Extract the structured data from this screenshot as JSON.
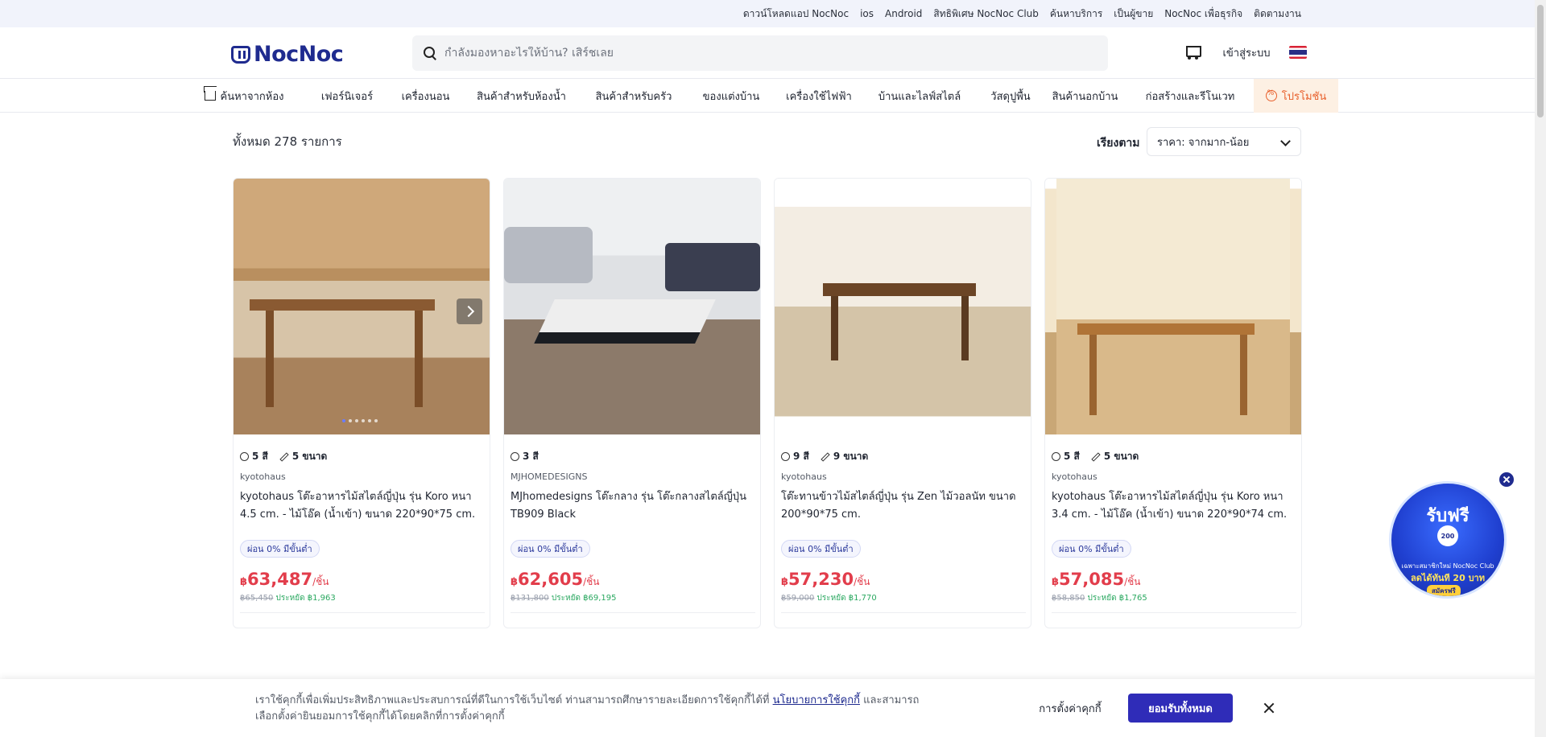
{
  "topbar": {
    "download_app": "ดาวน์โหลดแอป NocNoc",
    "links": [
      "ios",
      "Android",
      "สิทธิพิเศษ NocNoc Club",
      "ค้นหาบริการ",
      "เป็นผู้ขาย",
      "NocNoc เพื่อธุรกิจ",
      "ติดตามงาน"
    ]
  },
  "header": {
    "logo_text": "NocNoc",
    "search_placeholder": "กำลังมองหาอะไรให้บ้าน? เสิร์ชเลย",
    "login_label": "เข้าสู่ระบบ"
  },
  "categories": [
    "ค้นหาจากห้อง",
    "เฟอร์นิเจอร์",
    "เครื่องนอน",
    "สินค้าสำหรับห้องน้ำ",
    "สินค้าสำหรับครัว",
    "ของแต่งบ้าน",
    "เครื่องใช้ไฟฟ้า",
    "บ้านและไลฟ์สไตล์",
    "วัสดุปูพื้น",
    "สินค้านอกบ้าน",
    "ก่อสร้างและรีโนเวท",
    "โปรโมชัน"
  ],
  "listing": {
    "total": "ทั้งหมด 278 รายการ",
    "sort_label": "เรียงตาม",
    "sort_value": "ราคา: จากมาก-น้อย"
  },
  "products": [
    {
      "colors": "5 สี",
      "sizes": "5 ขนาด",
      "brand": "kyotohaus",
      "name": "kyotohaus โต๊ะอาหารไม้สไตล์ญี่ปุ่น รุ่น Koro หนา 4.5 cm. - ไม้โอ๊ค (น้ำเข้า) ขนาด 220*90*75 cm.",
      "installment": "ผ่อน 0% มีขั้นต่ำ",
      "currency": "฿",
      "price": "63,487",
      "unit": "/ชิ้น",
      "old_price": "฿65,450",
      "saving": "ประหยัด ฿1,963"
    },
    {
      "colors": "3 สี",
      "sizes": "",
      "brand": "MJHOMEDESIGNS",
      "name": "MJhomedesigns โต๊ะกลาง รุ่น โต๊ะกลางสไตล์ญี่ปุ่น TB909 Black",
      "installment": "ผ่อน 0% มีขั้นต่ำ",
      "currency": "฿",
      "price": "62,605",
      "unit": "/ชิ้น",
      "old_price": "฿131,800",
      "saving": "ประหยัด ฿69,195"
    },
    {
      "colors": "9 สี",
      "sizes": "9 ขนาด",
      "brand": "kyotohaus",
      "name": "โต๊ะทานข้าวไม้สไตล์ญี่ปุ่น รุ่น Zen ไม้วอลนัท ขนาด 200*90*75 cm.",
      "installment": "ผ่อน 0% มีขั้นต่ำ",
      "currency": "฿",
      "price": "57,230",
      "unit": "/ชิ้น",
      "old_price": "฿59,000",
      "saving": "ประหยัด ฿1,770"
    },
    {
      "colors": "5 สี",
      "sizes": "5 ขนาด",
      "brand": "kyotohaus",
      "name": "kyotohaus โต๊ะอาหารไม้สไตล์ญี่ปุ่น รุ่น Koro หนา 3.4 cm. - ไม้โอ๊ค (น้ำเข้า) ขนาด 220*90*74 cm.",
      "installment": "ผ่อน 0% มีขั้นต่ำ",
      "currency": "฿",
      "price": "57,085",
      "unit": "/ชิ้น",
      "old_price": "฿58,850",
      "saving": "ประหยัด ฿1,765"
    }
  ],
  "cookie": {
    "text_before": "เราใช้คุกกี้เพื่อเพิ่มประสิทธิภาพและประสบการณ์ที่ดีในการใช้เว็บไซต์ ท่านสามารถศึกษารายละเอียดการใช้คุกกี้ได้ที่ ",
    "policy_link": "นโยบายการใช้คุกกี้",
    "text_after": " และสามารถเลือกตั้งค่ายินยอมการใช้คุกกี้ได้โดยคลิกที่การตั้งค่าคุกกี้",
    "settings_label": "การตั้งค่าคุกกี้",
    "accept_label": "ยอมรับทั้งหมด"
  },
  "float_promo": {
    "title": "รับฟรี",
    "badge": "200",
    "subtitle": "เฉพาะสมาชิกใหม่ NocNoc Club",
    "discount": "ลดได้ทันที 20 บาท",
    "cta": "สมัครฟรี"
  },
  "colors": {
    "brand": "#1f2b8f",
    "price": "#e23d4b",
    "accept_button": "#2f2cb8",
    "promo_tab": "#e8602c"
  }
}
